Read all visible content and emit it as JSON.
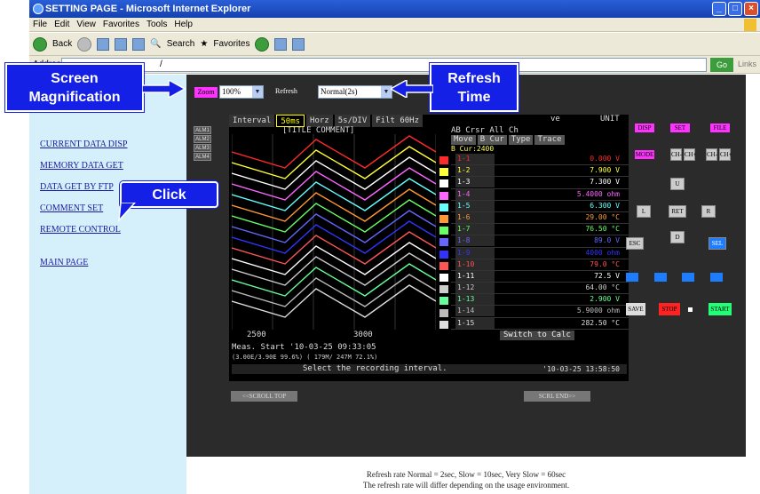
{
  "browser": {
    "title": "SETTING PAGE - Microsoft Internet Explorer",
    "menu": [
      "File",
      "Edit",
      "View",
      "Favorites",
      "Tools",
      "Help"
    ],
    "toolbar": {
      "back": "Back",
      "search": "Search",
      "favorites": "Favorites"
    },
    "address_prefix": "Address",
    "address_value": "/",
    "go": "Go",
    "links": "Links"
  },
  "sidebar": {
    "items": [
      "CURRENT DATA DISP",
      "MEMORY DATA GET",
      "DATA GET BY FTP",
      "COMMENT SET",
      "REMOTE CONTROL",
      "MAIN PAGE"
    ]
  },
  "controls": {
    "zoom_label": "Zoom",
    "zoom_value": "100%",
    "refresh_label": "Refresh",
    "refresh_value": "Normal(2s)"
  },
  "alm": [
    "ALM1",
    "ALM2",
    "ALM3",
    "ALM4"
  ],
  "screen": {
    "tabs": [
      "Interval",
      "50ms",
      "Horz",
      "5s/DIV",
      "Filt 60Hz"
    ],
    "tab_right": [
      "ve",
      "UNIT"
    ],
    "title_comment": "[TITLE COMMENT]",
    "x_ticks": [
      "2500",
      "3000"
    ],
    "meas_start": "Meas. Start  '10-03-25 09:33:05",
    "meas_detail": "(3.00E/3.90E 99.6%)     ( 179M/ 247M 72.1%)",
    "hint": "Select the recording interval.",
    "datetime": "'10-03-25 13:58:50",
    "data_panel": {
      "header": "AB Crsr All Ch",
      "tabs": [
        "Move",
        "B Cur",
        "Type",
        "Trace"
      ],
      "cursor": "B Cur:2400",
      "rows": [
        {
          "ch": "1-1",
          "value": "0.000 V",
          "color": "#ff2a2a"
        },
        {
          "ch": "1-2",
          "value": "7.900 V",
          "color": "#ffff33"
        },
        {
          "ch": "1-3",
          "value": "7.300 V",
          "color": "#ffffff"
        },
        {
          "ch": "1-4",
          "value": "5.4000 ohm",
          "color": "#ff66ff"
        },
        {
          "ch": "1-5",
          "value": "6.300 V",
          "color": "#66ffff"
        },
        {
          "ch": "1-6",
          "value": "29.00 °C",
          "color": "#ff9933"
        },
        {
          "ch": "1-7",
          "value": "76.50 °C",
          "color": "#66ff66"
        },
        {
          "ch": "1-8",
          "value": "89.0 V",
          "color": "#6666ff"
        },
        {
          "ch": "1-9",
          "value": "4000 ohm",
          "color": "#3333ff"
        },
        {
          "ch": "1-10",
          "value": "79.0 °C",
          "color": "#ff5555"
        },
        {
          "ch": "1-11",
          "value": "72.5 V",
          "color": "#ffffff"
        },
        {
          "ch": "1-12",
          "value": "64.00 °C",
          "color": "#cccccc"
        },
        {
          "ch": "1-13",
          "value": "2.900 V",
          "color": "#66ff99"
        },
        {
          "ch": "1-14",
          "value": "5.9000 ohm",
          "color": "#bbbbbb"
        },
        {
          "ch": "1-15",
          "value": "282.50 °C",
          "color": "#dddddd"
        }
      ],
      "switch_calc": "Switch to Calc"
    }
  },
  "right_buttons": {
    "disp": "DISP",
    "set": "SET",
    "file": "FILE",
    "mode": "MODE",
    "ch_minus_plus": [
      "CH-",
      "CH+"
    ],
    "scroll": [
      "U",
      "L",
      "RET",
      "R",
      "D"
    ],
    "esc": "ESC",
    "sel": "SEL",
    "save": "SAVE",
    "stop": "STOP",
    "start": "START"
  },
  "scroll_buttons": [
    "<<SCROLL TOP",
    "SCRL END>>"
  ],
  "footer": {
    "line1": "Refresh rate Normal = 2sec, Slow = 10sec, Very Slow = 60sec",
    "line2": "The refresh rate will differ depending on the usage environment."
  },
  "callouts": {
    "screen_mag": "Screen\nMagnification",
    "refresh_time": "Refresh\nTime",
    "click": "Click"
  },
  "colors": {
    "callout_bg": "#1520e6",
    "sidebar_bg": "#d6f0fb",
    "panel_bg": "#2b2b2b",
    "accent_magenta": "#ff33ff"
  }
}
